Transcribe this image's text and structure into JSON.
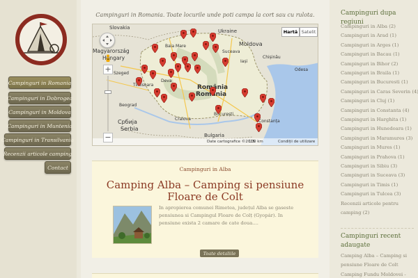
{
  "site": {
    "tagline": "Campinguri in Romania. Toate locurile unde poti campa la cort sau cu rulota."
  },
  "nav": {
    "items": [
      {
        "label": "Campinguri in Romania",
        "active": true
      },
      {
        "label": "Campinguri in Dobrogea"
      },
      {
        "label": "Campinguri in Moldova"
      },
      {
        "label": "Campinguri in Muntenia"
      },
      {
        "label": "Campinguri in Transilvania"
      },
      {
        "label": "Recenzii articole camping"
      },
      {
        "label": "Contact"
      }
    ]
  },
  "map": {
    "type_map": "Hartă",
    "type_satellite": "Satelit",
    "labels": {
      "slovakia": "Slovakia",
      "ukraine": "Ukraine",
      "hungary": "Magyarország",
      "hungary2": "Hungary",
      "moldova": "Moldova",
      "romania_ro": "România",
      "romania": "Romania",
      "serbia_sr": "Србија",
      "serbia": "Serbia",
      "bulgaria_bg": "България",
      "bulgaria": "Bulgaria",
      "szeged": "Szeged",
      "beograd": "Beograd",
      "timisoara": "Timisoara",
      "deva": "Deva",
      "baia_mare": "Baia Mare",
      "suceava": "Suceava",
      "iasi": "Iași",
      "bucuresti": "București",
      "craiova": "Craiova",
      "constanta": "Constanța",
      "chisinau": "Chișinău",
      "odesa": "Odesa",
      "pleven": "Плевен",
      "varna": "Варна"
    },
    "footer_data": "Date cartografice ©2015",
    "footer_scale": "100 km",
    "footer_terms": "Condiții de utilizare",
    "pins_color": "#d63b2f"
  },
  "post": {
    "category": "Campinguri in Alba",
    "title": "Camping Alba – Camping si pensiune Floare de Colt",
    "excerpt": "In apropierea comunei Rimetea, județul Alba se gaseste pensiunea si Campingul Floare de Colț (Gyopár). In pensiune exista 2 camare de cate doua....",
    "read_more": "Toate detaliile"
  },
  "sidebar": {
    "regions_title": "Campinguri dupa regiuni",
    "regions": [
      "Campinguri in Alba (2)",
      "Campinguri in Arad (1)",
      "Campinguri in Arges (1)",
      "Campinguri in Bacau (1)",
      "Campinguri in Bihor (2)",
      "Campinguri in Braila (1)",
      "Campinguri in Bucuresti (1)",
      "Campinguri in Caras Severin (4)",
      "Campinguri in Cluj (1)",
      "Campinguri in Constanta (4)",
      "Campinguri in Harghita (1)",
      "Campinguri in Hunedoara (1)",
      "Campinguri in Maramures (3)",
      "Campinguri in Mures (1)",
      "Campinguri in Prahova (1)",
      "Campinguri in Sibiu (3)",
      "Campinguri in Suceava (3)",
      "Campinguri in Timis (1)",
      "Campinguri in Tulcea (3)"
    ],
    "reviews_line1": "Recenzii articole pentru",
    "reviews_line2": "camping (2)",
    "recent_title_1": "Campinguri recent",
    "recent_title_2": "adaugate",
    "recent": [
      {
        "line1": "Camping Alba – Camping si",
        "line2": "pensiune Floare de Colt"
      },
      {
        "line1": "Camping Fundu Moldovei -",
        "line2": ""
      }
    ]
  }
}
